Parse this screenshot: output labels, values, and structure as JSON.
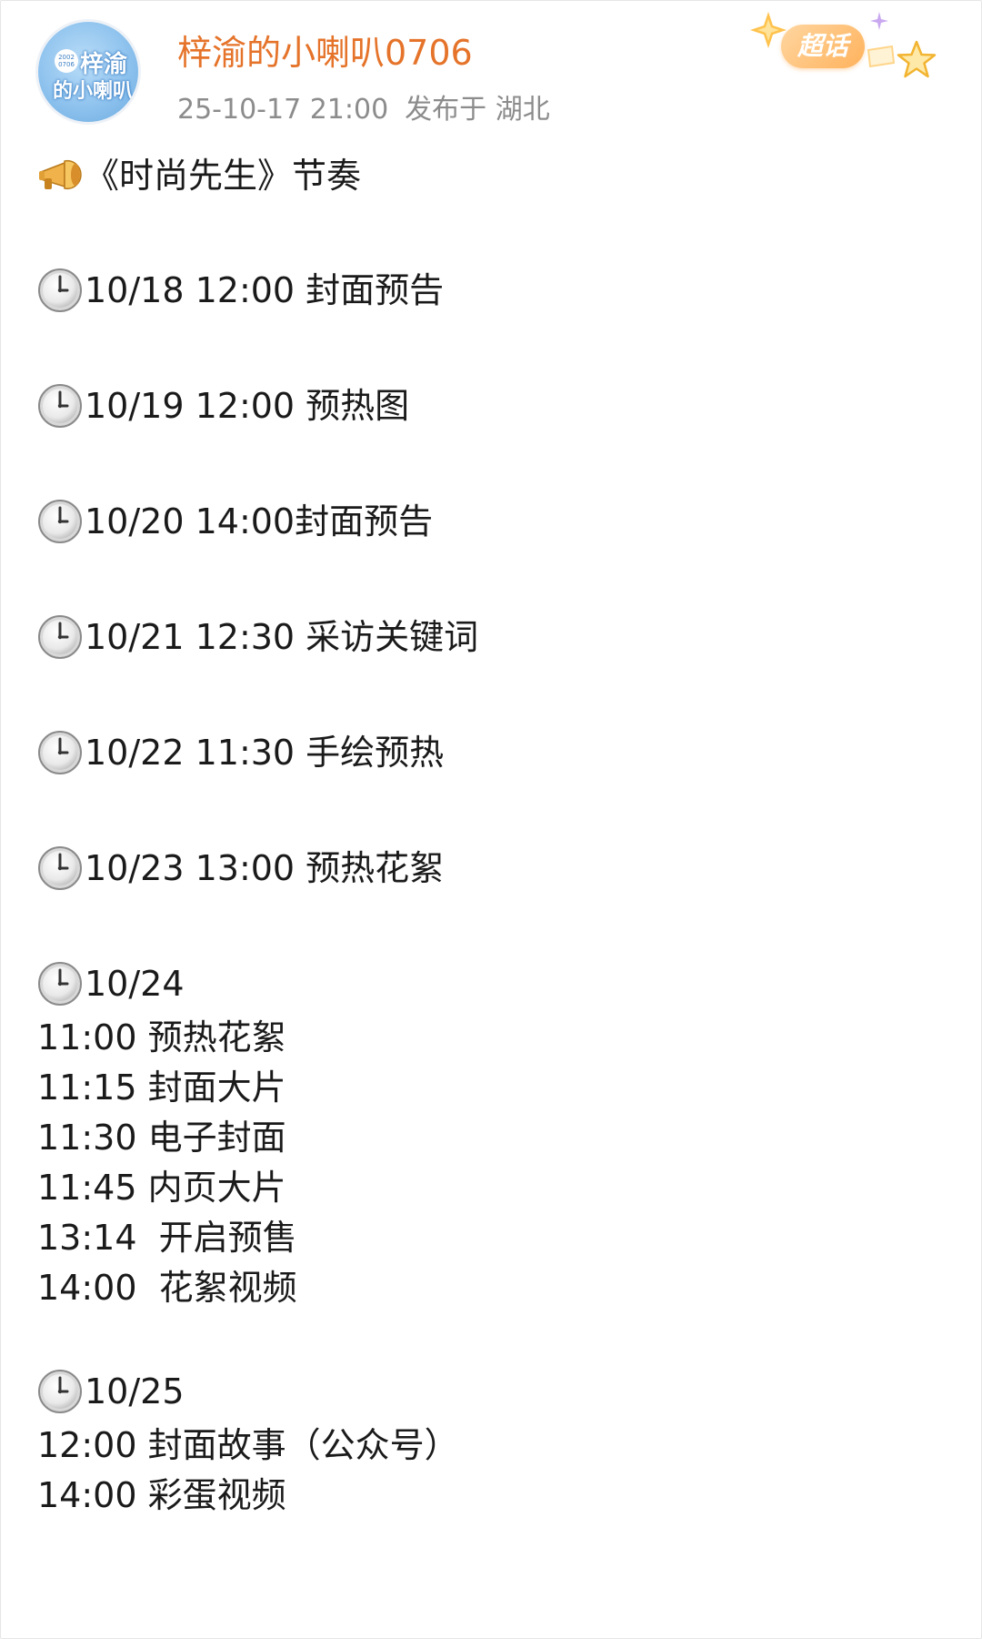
{
  "post": {
    "author": {
      "name": "梓渝的小喇叭0706",
      "avatar_text_line1": "梓渝",
      "avatar_text_line2": "的小喇叭",
      "avatar_badge": "2002 0706"
    },
    "timestamp": "25-10-17 21:00",
    "location": "发布于 湖北",
    "supertopic_badge": "超话",
    "title": "《时尚先生》节奏",
    "schedule": [
      {
        "date_time": "10/18 12:00 封面预告",
        "items": []
      },
      {
        "date_time": "10/19 12:00 预热图",
        "items": []
      },
      {
        "date_time": "10/20 14:00封面预告",
        "items": []
      },
      {
        "date_time": "10/21 12:30 采访关键词",
        "items": []
      },
      {
        "date_time": "10/22 11:30 手绘预热",
        "items": []
      },
      {
        "date_time": "10/23 13:00 预热花絮",
        "items": []
      },
      {
        "date_time": "10/24",
        "items": [
          "11:00 预热花絮",
          "11:15 封面大片",
          "11:30 电子封面",
          "11:45 内页大片",
          "13:14  开启预售",
          "14:00  花絮视频"
        ]
      },
      {
        "date_time": "10/25",
        "items": [
          "12:00 封面故事（公众号）",
          "14:00 彩蛋视频"
        ]
      }
    ]
  },
  "colors": {
    "author_name": "#e5732a",
    "meta_text": "#8c8c8c",
    "body_text": "#1a1a1a",
    "badge_orange": "#ffb25c"
  },
  "icons": {
    "title_icon": "megaphone-icon",
    "entry_icon": "clock-icon",
    "badge_icon": "star-icon"
  }
}
